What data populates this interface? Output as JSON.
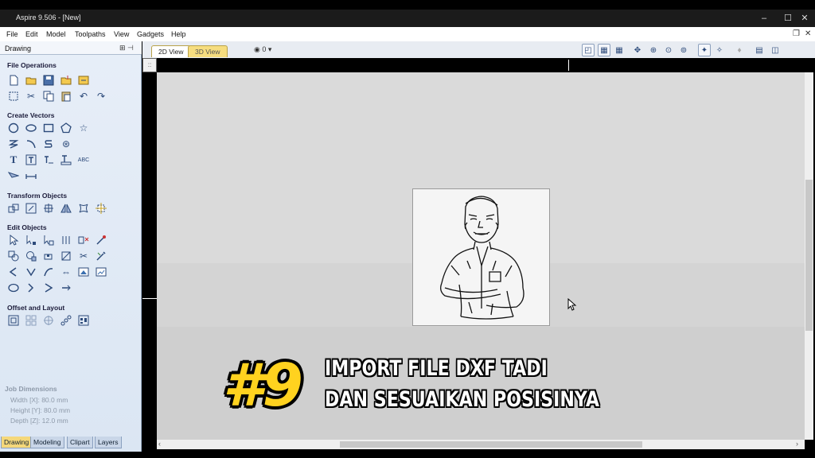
{
  "window": {
    "title": "Aspire 9.506 - [New]",
    "minimize_glyph": "–",
    "maximize_glyph": "☐",
    "close_glyph": "✕"
  },
  "menu": {
    "items": [
      "File",
      "Edit",
      "Model",
      "Toolpaths",
      "View",
      "Gadgets",
      "Help"
    ],
    "restore_glyph": "❐",
    "close_glyph": "✕"
  },
  "panel": {
    "title": "Drawing",
    "pin_glyph": "⊞ ⊣",
    "sections": {
      "file_operations": "File Operations",
      "create_vectors": "Create Vectors",
      "transform_objects": "Transform Objects",
      "edit_objects": "Edit Objects",
      "offset_layout": "Offset and Layout"
    },
    "job_dimensions": {
      "title": "Job Dimensions",
      "width": "Width  [X]: 80.0 mm",
      "height": "Height [Y]: 80.0 mm",
      "depth": "Depth  [Z]: 12.0 mm"
    },
    "bottom_tabs": [
      "Drawing",
      "Modeling",
      "Clipart",
      "Layers"
    ]
  },
  "view_tabs": {
    "tab_2d": "2D View",
    "tab_3d": "3D View",
    "layer_selector": "0"
  },
  "caption": {
    "number": "#9",
    "line1": "IMPORT FILE DXF TADI",
    "line2": "DAN SESUAIKAN POSISINYA"
  },
  "colors": {
    "caption_number": "#ffd21f",
    "caption_text": "#ffffff",
    "panel_bg": "#dbe6f3",
    "canvas_bg": "#d9d9d9"
  }
}
